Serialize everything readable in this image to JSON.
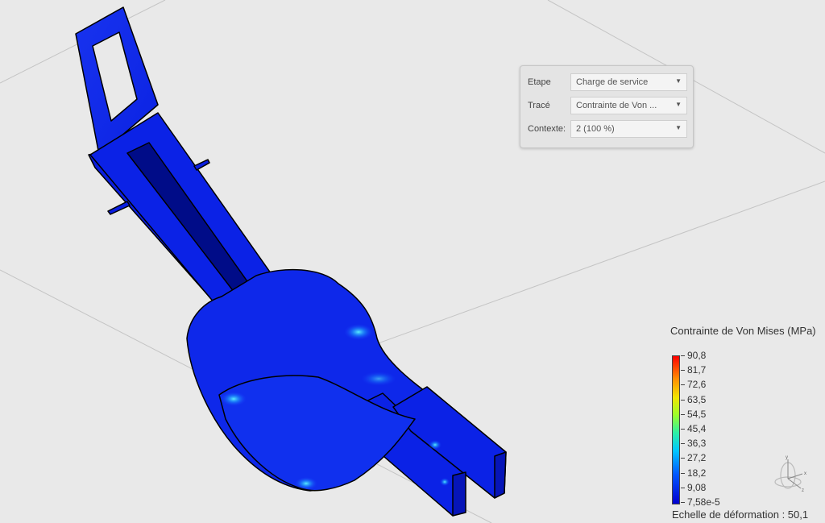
{
  "study_options": {
    "rows": [
      {
        "label": "Etape",
        "value": "Charge de service"
      },
      {
        "label": "Tracé",
        "value": "Contrainte de Von ..."
      },
      {
        "label": "Contexte:",
        "value": "2 (100 %)"
      }
    ]
  },
  "legend": {
    "title": "Contrainte de Von Mises (MPa)",
    "ticks": [
      "90,8",
      "81,7",
      "72,6",
      "63,5",
      "54,5",
      "45,4",
      "36,3",
      "27,2",
      "18,2",
      "9,08",
      "7,58e-5"
    ],
    "deformation": "Echelle de déformation : 50,1"
  },
  "triad": {
    "x_label": "x",
    "y_label": "y",
    "z_label": "z"
  },
  "colors": {
    "part": "#0a1ee0",
    "part_edge": "#000000",
    "background": "#e9e9e9",
    "hotspot": "#2ff0ff"
  }
}
